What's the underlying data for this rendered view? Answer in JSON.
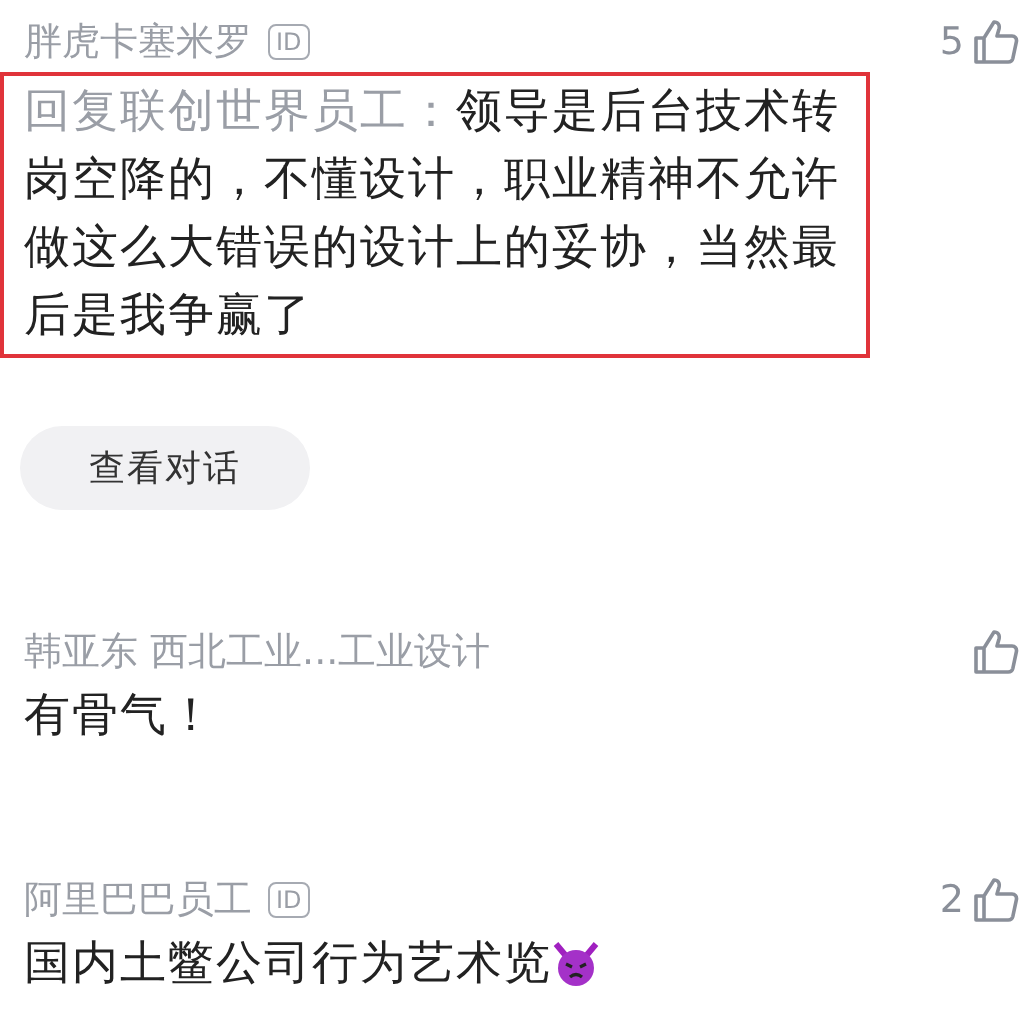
{
  "comments": [
    {
      "author": "胖虎卡塞米罗",
      "badge": "ID",
      "likes": "5",
      "reply_to": "回复联创世界员工：",
      "text": "领导是后台技术转岗空降的，不懂设计，职业精神不允许做这么大错误的设计上的妥协，当然最后是我争赢了",
      "highlighted": true,
      "action": "查看对话"
    },
    {
      "author": "韩亚东 西北工业...工业设计",
      "text": "有骨气！",
      "highlighted": false
    },
    {
      "author": "阿里巴巴员工",
      "badge": "ID",
      "likes": "2",
      "text": "国内土鳖公司行为艺术览",
      "highlighted": false,
      "kind": "devil_emoji"
    }
  ]
}
